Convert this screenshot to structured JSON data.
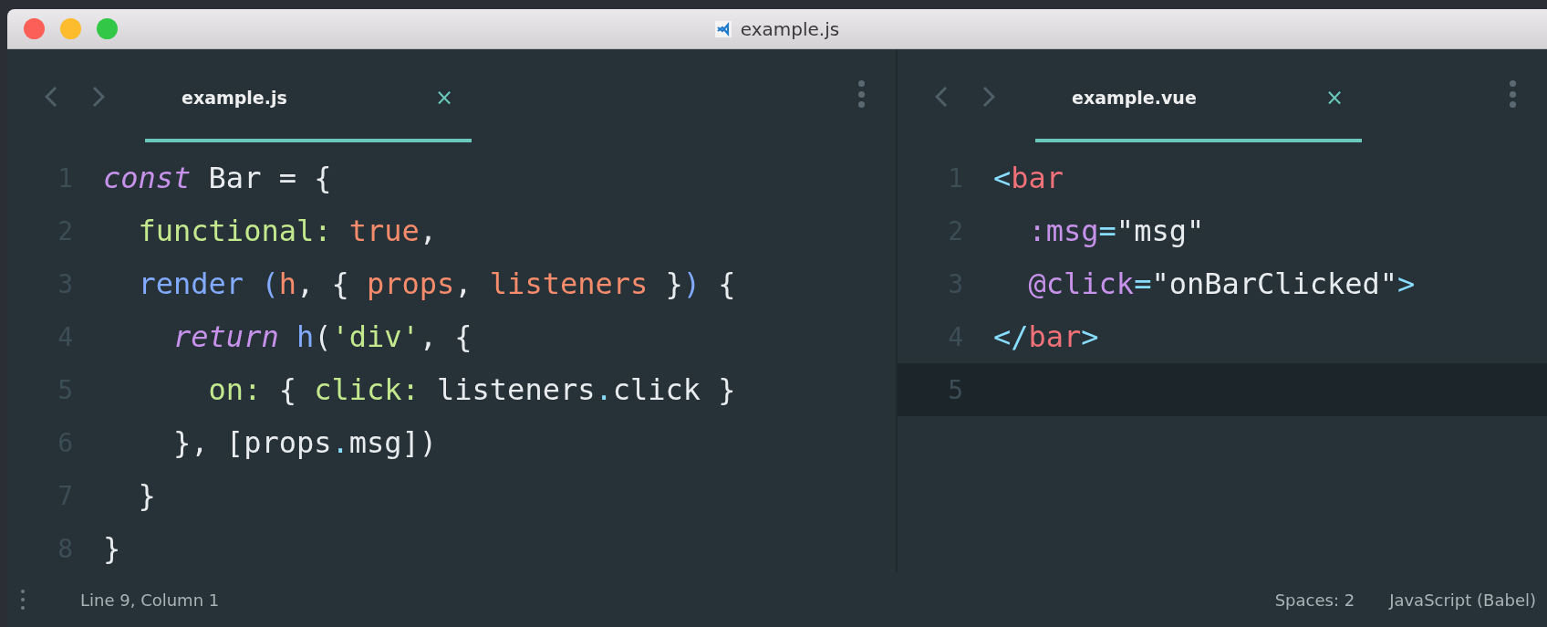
{
  "window": {
    "title": "example.js"
  },
  "panes": [
    {
      "tab": {
        "label": "example.js",
        "close": "×",
        "selected": true
      },
      "lines": [
        {
          "number": "1",
          "highlighted": false,
          "tokens": [
            {
              "kind": "keyword",
              "text": "const"
            },
            {
              "kind": "plain",
              "text": " Bar = {"
            }
          ]
        },
        {
          "number": "2",
          "highlighted": false,
          "tokens": [
            {
              "kind": "property",
              "text": "  functional: "
            },
            {
              "kind": "constant",
              "text": "true"
            },
            {
              "kind": "plain",
              "text": ","
            }
          ]
        },
        {
          "number": "3",
          "highlighted": false,
          "tokens": [
            {
              "kind": "function",
              "text": "  render ("
            },
            {
              "kind": "param",
              "text": "h"
            },
            {
              "kind": "plain",
              "text": ", { "
            },
            {
              "kind": "param",
              "text": "props"
            },
            {
              "kind": "plain",
              "text": ", "
            },
            {
              "kind": "param",
              "text": "listeners"
            },
            {
              "kind": "plain",
              "text": " }"
            },
            {
              "kind": "function",
              "text": ")"
            },
            {
              "kind": "plain",
              "text": " {"
            }
          ]
        },
        {
          "number": "4",
          "highlighted": false,
          "tokens": [
            {
              "kind": "keyword",
              "text": "    return "
            },
            {
              "kind": "function",
              "text": "h"
            },
            {
              "kind": "plain",
              "text": "("
            },
            {
              "kind": "property",
              "text": "'div'"
            },
            {
              "kind": "plain",
              "text": ", {"
            }
          ]
        },
        {
          "number": "5",
          "highlighted": false,
          "tokens": [
            {
              "kind": "property",
              "text": "      on:"
            },
            {
              "kind": "plain",
              "text": " { "
            },
            {
              "kind": "property",
              "text": "click:"
            },
            {
              "kind": "plain",
              "text": " listeners"
            },
            {
              "kind": "operator",
              "text": "."
            },
            {
              "kind": "plain",
              "text": "click }"
            }
          ]
        },
        {
          "number": "6",
          "highlighted": false,
          "tokens": [
            {
              "kind": "plain",
              "text": "    }, [props"
            },
            {
              "kind": "operator",
              "text": "."
            },
            {
              "kind": "plain",
              "text": "msg])"
            }
          ]
        },
        {
          "number": "7",
          "highlighted": false,
          "tokens": [
            {
              "kind": "plain",
              "text": "  }"
            }
          ]
        },
        {
          "number": "8",
          "highlighted": false,
          "tokens": [
            {
              "kind": "plain",
              "text": "}"
            }
          ]
        }
      ]
    },
    {
      "tab": {
        "label": "example.vue",
        "close": "×",
        "selected": true
      },
      "lines": [
        {
          "number": "1",
          "highlighted": false,
          "tokens": [
            {
              "kind": "operator",
              "text": "<"
            },
            {
              "kind": "tag",
              "text": "bar"
            }
          ]
        },
        {
          "number": "2",
          "highlighted": false,
          "tokens": [
            {
              "kind": "attr",
              "text": "  :msg"
            },
            {
              "kind": "operator",
              "text": "="
            },
            {
              "kind": "plain",
              "text": "\"msg\""
            }
          ]
        },
        {
          "number": "3",
          "highlighted": false,
          "tokens": [
            {
              "kind": "attr",
              "text": "  @click"
            },
            {
              "kind": "operator",
              "text": "="
            },
            {
              "kind": "plain",
              "text": "\"onBarClicked\""
            },
            {
              "kind": "operator",
              "text": ">"
            }
          ]
        },
        {
          "number": "4",
          "highlighted": false,
          "tokens": [
            {
              "kind": "operator",
              "text": "</"
            },
            {
              "kind": "tag",
              "text": "bar"
            },
            {
              "kind": "operator",
              "text": ">"
            }
          ]
        },
        {
          "number": "5",
          "highlighted": true
        }
      ]
    }
  ],
  "status_bar": {
    "position": "Line 9, Column 1",
    "indentation": "Spaces: 2",
    "syntax": "JavaScript (Babel)"
  }
}
